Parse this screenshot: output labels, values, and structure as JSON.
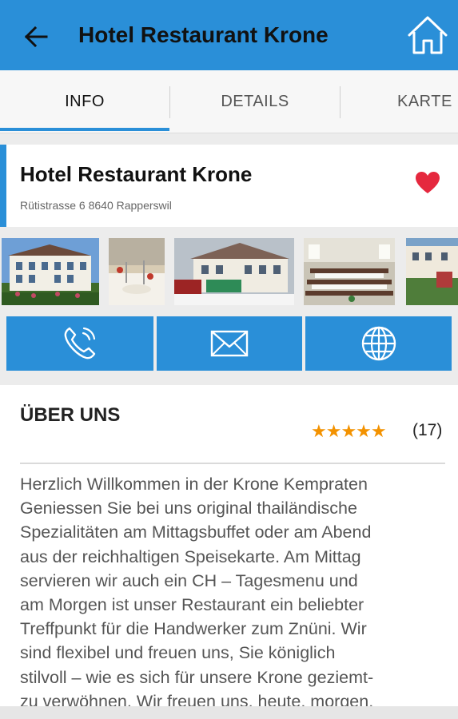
{
  "header": {
    "title": "Hotel Restaurant Krone",
    "back_icon": "arrow-left-icon",
    "home_icon": "home-icon"
  },
  "tabs": [
    {
      "label": "INFO",
      "active": true
    },
    {
      "label": "DETAILS",
      "active": false
    },
    {
      "label": "KARTE",
      "active": false
    }
  ],
  "hotel": {
    "name": "Hotel Restaurant Krone",
    "address": "Rütistrasse 6 8640 Rapperswil",
    "favorite_icon": "heart-icon"
  },
  "gallery": {
    "photos": [
      "hotel-exterior-photo",
      "restaurant-table-photo",
      "hotel-winter-photo",
      "dining-room-photo",
      "terrace-photo"
    ]
  },
  "actions": [
    {
      "icon": "phone-icon"
    },
    {
      "icon": "mail-icon"
    },
    {
      "icon": "globe-icon"
    }
  ],
  "about": {
    "title": "ÜBER UNS",
    "stars": "★★★★★",
    "rating_count": "(17)",
    "lines": [
      "Herzlich Willkommen in der Krone Kempraten",
      "Geniessen Sie bei uns original thailändische",
      "Spezialitäten am Mittagsbuffet oder am Abend",
      "aus der reichhaltigen Speisekarte. Am Mittag",
      "servieren wir auch ein CH – Tagesmenu und",
      "am Morgen ist unser Restaurant ein beliebter",
      "Treffpunkt für die Handwerker zum Znüni. Wir",
      "sind flexibel und freuen uns, Sie königlich",
      "stilvoll – wie es sich für unsere Krone geziemt-",
      "zu verwöhnen. Wir freuen uns, heute, morgen,"
    ]
  },
  "colors": {
    "primary": "#2a8fd8",
    "star": "#f39200",
    "heart": "#e5283e"
  }
}
